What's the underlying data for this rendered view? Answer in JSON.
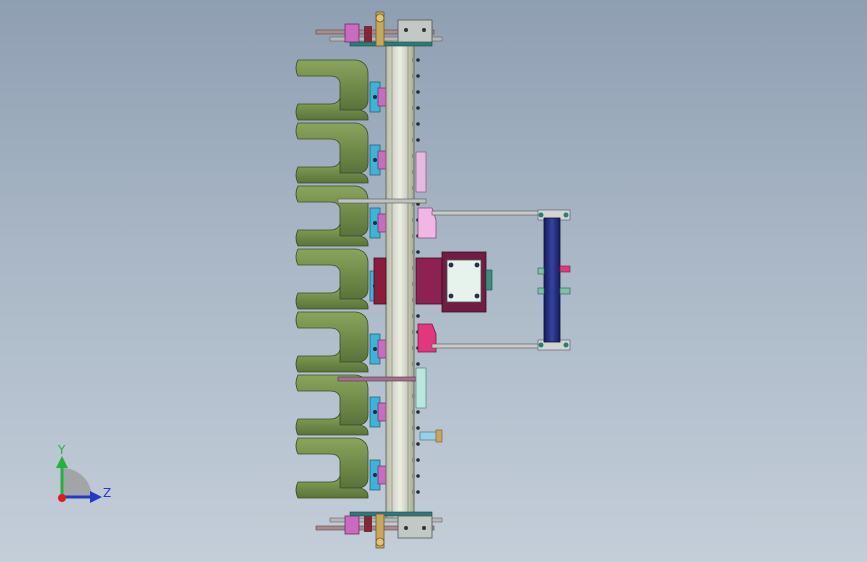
{
  "viewport": {
    "background_top": "#8f9fb2",
    "background_bottom": "#c4ced9"
  },
  "model": {
    "colors": {
      "blade": "#6f8b4a",
      "blade_edge": "#3b4d27",
      "shaft": "#d7d9c8",
      "flange": "#3fb3d6",
      "gearbox_body": "#8b2252",
      "gearbox_cover": "#e6f2ec",
      "frame_bar": "#232c78",
      "arm": "#c9c9c9",
      "accent_pink": "#e9b7e3",
      "accent_magenta": "#e0377f",
      "teal": "#1f9e8b",
      "hub": "#c96bbf"
    },
    "blade_count": 7
  },
  "triad": {
    "x_label": "",
    "y_label": "Y",
    "z_label": "Z",
    "y_color": "#22b43a",
    "z_color": "#2638c8",
    "x_color": "#d42020"
  }
}
